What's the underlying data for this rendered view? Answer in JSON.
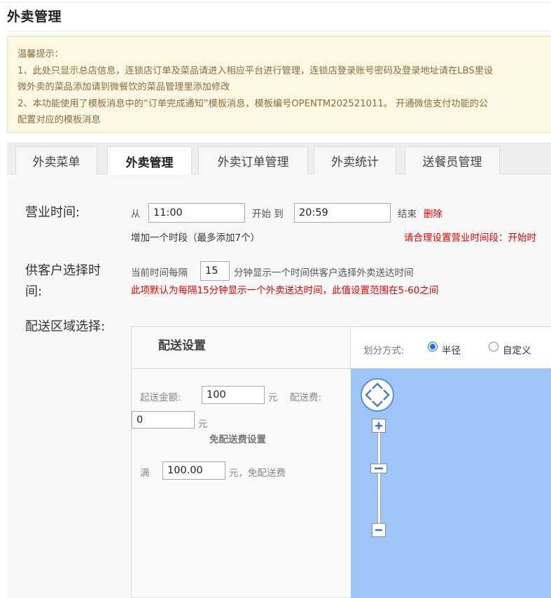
{
  "page": {
    "title": "外卖管理"
  },
  "notice": {
    "lines": [
      "温馨提示：",
      "1、此处只显示总店信息，连锁店订单及菜品请进入相应平台进行管理，连锁店登录账号密码及登录地址请在LBS里设",
      "微外卖的菜品添加请到微餐饮的菜品管理里添加修改",
      "2、本功能使用了模板消息中的“订单完成通知”模板消息，模板编号OPENTM202521011。 开通微信支付功能的公",
      "配置对应的模板消息"
    ]
  },
  "tabs": [
    {
      "label": "外卖菜单",
      "active": false
    },
    {
      "label": "外卖管理",
      "active": true
    },
    {
      "label": "外卖订单管理",
      "active": false
    },
    {
      "label": "外卖统计",
      "active": false
    },
    {
      "label": "送餐员管理",
      "active": false
    }
  ],
  "business_hours": {
    "label": "营业时间:",
    "from_text": "从",
    "start_value": "11:00",
    "start_to_text": "开始 到",
    "end_value": "20:59",
    "end_text": "结束",
    "delete_label": "删除",
    "add_period": "增加一个时段（最多添加7个）",
    "warning": "请合理设置营业时间段：开始时"
  },
  "customer_interval": {
    "label_line1": "供客户选择时",
    "label_line2": "间:",
    "prefix": "当前时间每隔",
    "value": "15",
    "suffix": "分钟显示一个时间供客户选择外卖送达时间",
    "hint": "此项默认为每隔15分钟显示一个外卖送达时间，此值设置范围在5-60之间"
  },
  "delivery": {
    "area_label": "配送区域选择:",
    "settings_title": "配送设置",
    "mode_label": "划分方式:",
    "mode_options": [
      {
        "label": "半径",
        "selected": true
      },
      {
        "label": "自定义",
        "selected": false
      }
    ],
    "min_amount_label": "起送金额:",
    "min_amount_value": "100",
    "yuan": "元",
    "fee_label": "配送费:",
    "fee_value": "0",
    "free_title": "免配送费设置",
    "full_label": "满",
    "full_value": "100.00",
    "full_suffix": "元，免配送费"
  },
  "colors": {
    "notice_bg": "#fcf8e3",
    "notice_text": "#8a6d3b",
    "warning_red": "#e00000",
    "map_blue": "#9ec5f8",
    "radio_blue": "#1a73e8"
  }
}
